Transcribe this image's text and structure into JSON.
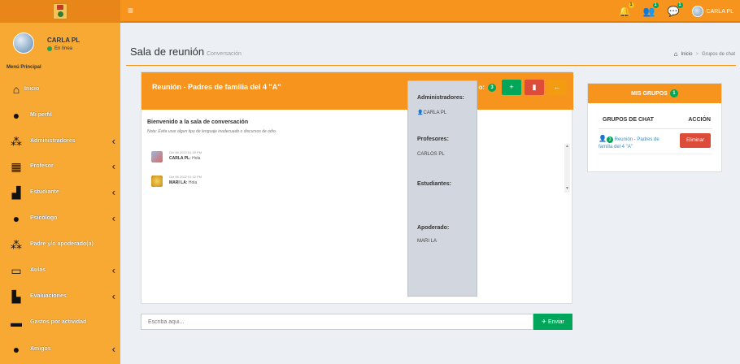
{
  "topbar": {
    "menu_icon": "bars-icon",
    "notifications": [
      {
        "icon": "bell-icon",
        "count": "1"
      },
      {
        "icon": "users-icon",
        "count": "1"
      },
      {
        "icon": "chat-icon",
        "count": "1"
      }
    ],
    "user_name": "CARLA PL"
  },
  "sidebar": {
    "user_name": "CARLA PL",
    "status": "En línea",
    "menu_header": "Menú Principal",
    "items": [
      {
        "label": "Inicio",
        "icon": "home-icon",
        "chevron": ""
      },
      {
        "label": "Mi perfil",
        "icon": "user-icon",
        "chevron": ""
      },
      {
        "label": "Administradores",
        "icon": "users-group-icon",
        "chevron": "‹"
      },
      {
        "label": "Profesor",
        "icon": "professor-icon",
        "chevron": "‹"
      },
      {
        "label": "Estudiante",
        "icon": "student-icon",
        "chevron": "‹"
      },
      {
        "label": "Psicólogo",
        "icon": "psychologist-icon",
        "chevron": "‹"
      },
      {
        "label": "Padre y/o apoderado(a)",
        "icon": "parents-icon",
        "chevron": ""
      },
      {
        "label": "Aulas",
        "icon": "classroom-icon",
        "chevron": "‹"
      },
      {
        "label": "Evaluaciones",
        "icon": "evaluations-icon",
        "chevron": "‹"
      },
      {
        "label": "Gastos por actividad",
        "icon": "money-icon",
        "chevron": ""
      },
      {
        "label": "Amigos",
        "icon": "friends-icon",
        "chevron": "‹"
      }
    ]
  },
  "page": {
    "title": "Sala de reunión",
    "subtitle": "Conversación",
    "breadcrumb": {
      "home": "Inicio",
      "separator": ">",
      "current": "Grupos de chat"
    }
  },
  "chat": {
    "title": "Reunión - Padres de familia del 4 \"A\"",
    "tools_label": "o:",
    "members_count": "3",
    "welcome": "Bienvenido a la sala de conversación",
    "note": "Nota: Evita usar algun tipo de lenguaje inadecuado o discursos de odio.",
    "messages": [
      {
        "time": "Oct 06 2022 01:30 PM",
        "user": "CARLA PL:",
        "text": "Hola"
      },
      {
        "time": "Oct 06 2022 01:32 PM",
        "user": "MARI LA:",
        "text": "Hola"
      }
    ],
    "input_placeholder": "Escriba aqui...",
    "send_label": "Enviar"
  },
  "members_popover": {
    "admins_label": "Administradores:",
    "admins": "CARLA PL",
    "teachers_label": "Profesores:",
    "teachers": "CARLOS PL",
    "students_label": "Estudiantes:",
    "students": "",
    "guardian_label": "Apoderado:",
    "guardian": "MARI LA"
  },
  "groups": {
    "title": "MIS GRUPOS",
    "count": "1",
    "col_name": "GRUPOS DE CHAT",
    "col_action": "ACCIÓN",
    "rows": [
      {
        "count": "3",
        "name": "Reunión - Padres de familia del 4 \"A\"",
        "action": "Eliminar"
      }
    ]
  },
  "colors": {
    "accent": "#f7941d",
    "sidebar": "#f7a934",
    "success": "#00a65a",
    "danger": "#dd4b39"
  }
}
